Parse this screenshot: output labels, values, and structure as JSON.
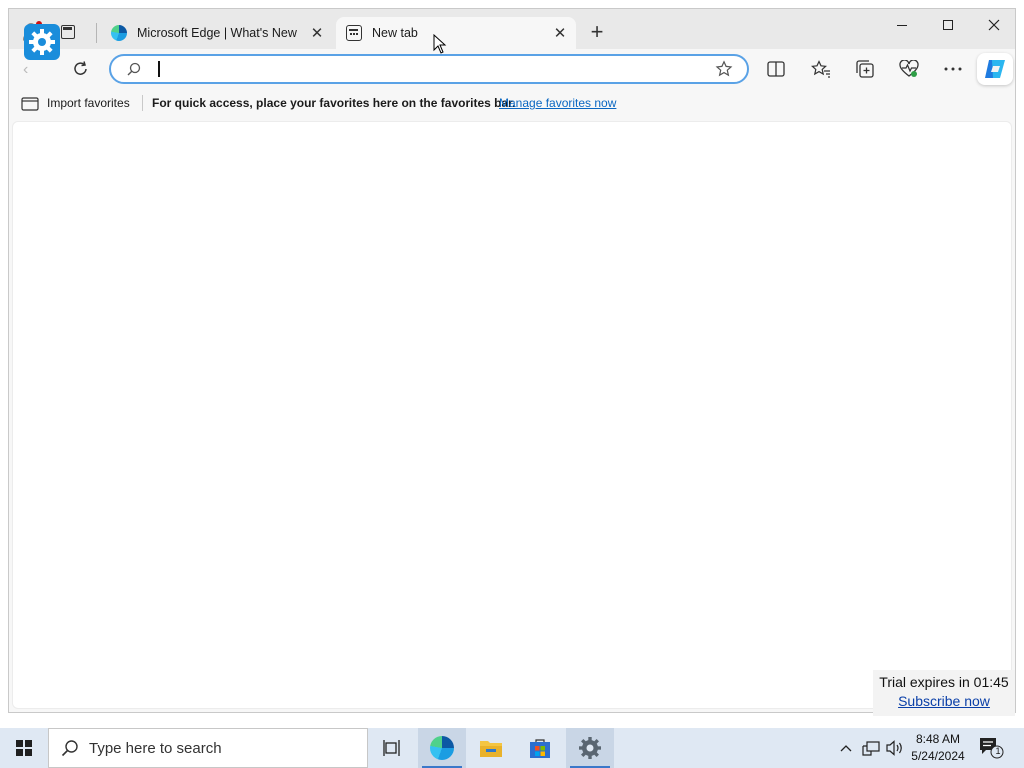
{
  "browser": {
    "tabs": [
      {
        "title": "Microsoft Edge | What's New",
        "icon": "edge-logo-icon",
        "active": false
      },
      {
        "title": "New tab",
        "icon": "new-tab-icon",
        "active": true
      }
    ],
    "address_bar": {
      "value": "",
      "placeholder": ""
    },
    "favorites_bar": {
      "import_label": "Import favorites",
      "message": "For quick access, place your favorites here on the favorites bar.",
      "manage_link": "Manage favorites now"
    }
  },
  "trial_popup": {
    "text": "Trial expires in 01:45",
    "link": "Subscribe now"
  },
  "taskbar": {
    "search_placeholder": "Type here to search",
    "time": "8:48 AM",
    "date": "5/24/2024",
    "notification_count": "1",
    "pinned_apps": [
      "task-view",
      "microsoft-edge",
      "file-explorer",
      "microsoft-store",
      "settings"
    ]
  },
  "colors": {
    "accent": "#0a67c2",
    "address_focus": "#5aa2e6",
    "taskbar_bg": "#dfe8f3",
    "settings_overlay": "#1a8ddb"
  }
}
